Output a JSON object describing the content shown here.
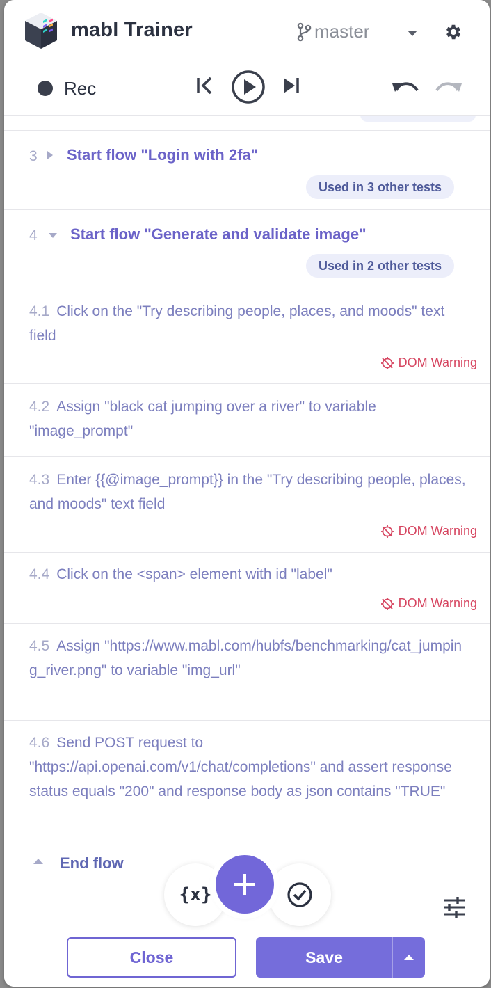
{
  "header": {
    "title": "mabl Trainer",
    "branch": "master"
  },
  "controls": {
    "rec_label": "Rec"
  },
  "steps": [
    {
      "number": "3",
      "title": "Start flow \"Login with 2fa\"",
      "badge": "Used in 3 other tests"
    },
    {
      "number": "4",
      "title": "Start flow \"Generate and validate image\"",
      "badge": "Used in 2 other tests"
    },
    {
      "number": "4.1",
      "text": "Click on the \"Try describing people, places, and moods\" text field",
      "warning": "DOM Warning"
    },
    {
      "number": "4.2",
      "text": "Assign \"black cat jumping over a river\" to variable \"image_prompt\""
    },
    {
      "number": "4.3",
      "text": "Enter {{@image_prompt}} in the \"Try describing people, places, and moods\" text field",
      "warning": "DOM Warning"
    },
    {
      "number": "4.4",
      "text": "Click on the <span> element with id \"label\"",
      "warning": "DOM Warning"
    },
    {
      "number": "4.5",
      "text": "Assign \"https://www.mabl.com/hubfs/benchmarking/cat_jumping_river.png\" to variable \"img_url\""
    },
    {
      "number": "4.6",
      "text": "Send POST request to \"https://api.openai.com/v1/chat/completions\" and assert response status equals \"200\" and response body as json contains \"TRUE\""
    },
    {
      "title": "End flow"
    }
  ],
  "footer": {
    "variables_label": "{x}",
    "close_label": "Close",
    "save_label": "Save"
  },
  "colors": {
    "accent": "#756ddb",
    "warning": "#d64560",
    "flow_title": "#6b63c8"
  }
}
